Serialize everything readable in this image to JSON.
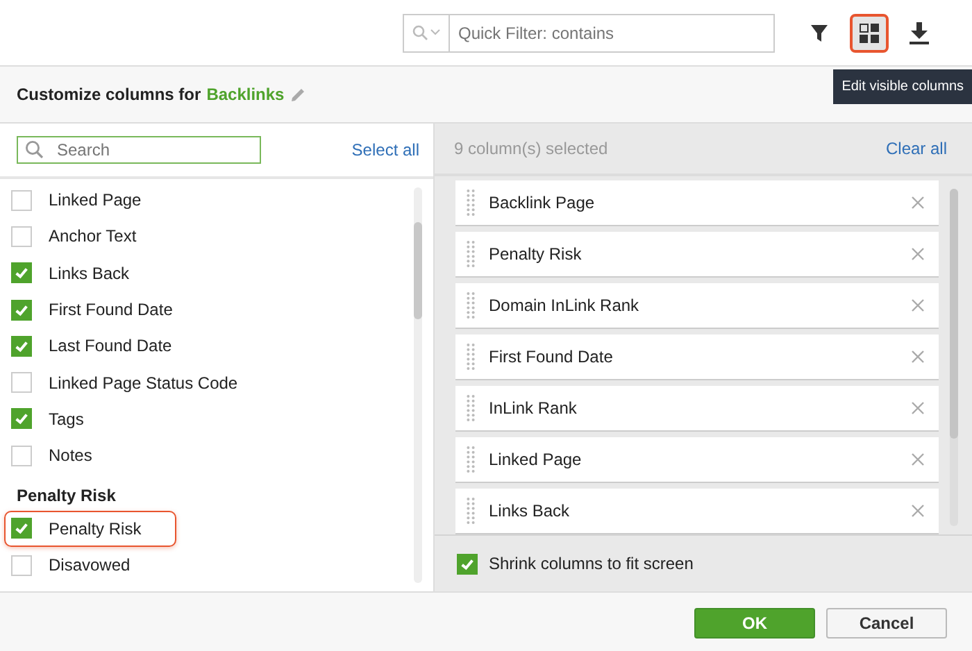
{
  "toolbar": {
    "quick_filter": {
      "placeholder": "Quick Filter: contains"
    },
    "buttons": [
      {
        "kind": "filter",
        "highlighted": false
      },
      {
        "kind": "columns",
        "highlighted": true
      },
      {
        "kind": "download",
        "highlighted": false
      }
    ],
    "tooltip": "Edit visible columns"
  },
  "dialog": {
    "title": "Customize columns for",
    "title_target": "Backlinks",
    "left": {
      "search": {
        "placeholder": "Search"
      },
      "select_all": "Select all",
      "items": [
        {
          "kind": "option",
          "label": "Linked Page",
          "checked": false,
          "highlighted": false
        },
        {
          "kind": "option",
          "label": "Anchor Text",
          "checked": false,
          "highlighted": false
        },
        {
          "kind": "option",
          "label": "Links Back",
          "checked": true,
          "highlighted": false
        },
        {
          "kind": "option",
          "label": "First Found Date",
          "checked": true,
          "highlighted": false
        },
        {
          "kind": "option",
          "label": "Last Found Date",
          "checked": true,
          "highlighted": false
        },
        {
          "kind": "option",
          "label": "Linked Page Status Code",
          "checked": false,
          "highlighted": false
        },
        {
          "kind": "option",
          "label": "Tags",
          "checked": true,
          "highlighted": false
        },
        {
          "kind": "option",
          "label": "Notes",
          "checked": false,
          "highlighted": false
        },
        {
          "kind": "group",
          "label": "Penalty Risk"
        },
        {
          "kind": "option",
          "label": "Penalty Risk",
          "checked": true,
          "highlighted": true
        },
        {
          "kind": "option",
          "label": "Disavowed",
          "checked": false,
          "highlighted": false
        }
      ]
    },
    "right": {
      "count": "9 column(s) selected",
      "clear_all": "Clear all",
      "columns": [
        "Backlink Page",
        "Penalty Risk",
        "Domain InLink Rank",
        "First Found Date",
        "InLink Rank",
        "Linked Page",
        "Links Back"
      ],
      "shrink": {
        "label": "Shrink columns to fit screen",
        "checked": true
      }
    },
    "buttons": {
      "ok": "OK",
      "cancel": "Cancel"
    }
  }
}
